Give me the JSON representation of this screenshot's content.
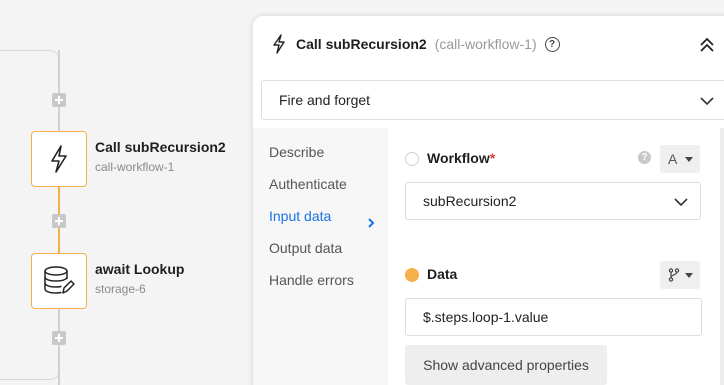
{
  "canvas": {
    "nodes": [
      {
        "title": "Call subRecursion2",
        "subtitle": "call-workflow-1",
        "icon": "lightning-icon"
      },
      {
        "title": "await Lookup",
        "subtitle": "storage-6",
        "icon": "database-edit-icon"
      }
    ]
  },
  "panel": {
    "title": "Call subRecursion2",
    "subtitle": "(call-workflow-1)",
    "help": "?",
    "mode": {
      "selected": "Fire and forget"
    },
    "nav": [
      {
        "label": "Describe",
        "active": false
      },
      {
        "label": "Authenticate",
        "active": false
      },
      {
        "label": "Input data",
        "active": true
      },
      {
        "label": "Output data",
        "active": false
      },
      {
        "label": "Handle errors",
        "active": false
      }
    ],
    "workflow": {
      "label": "Workflow",
      "required_mark": "*",
      "help": "?",
      "type_glyph": "A",
      "value": "subRecursion2"
    },
    "data": {
      "label": "Data",
      "value": "$.steps.loop-1.value"
    },
    "advanced_button": "Show advanced properties"
  },
  "colors": {
    "accent": "#f6b04a",
    "active_nav": "#1a73e8",
    "required": "#e53935"
  }
}
